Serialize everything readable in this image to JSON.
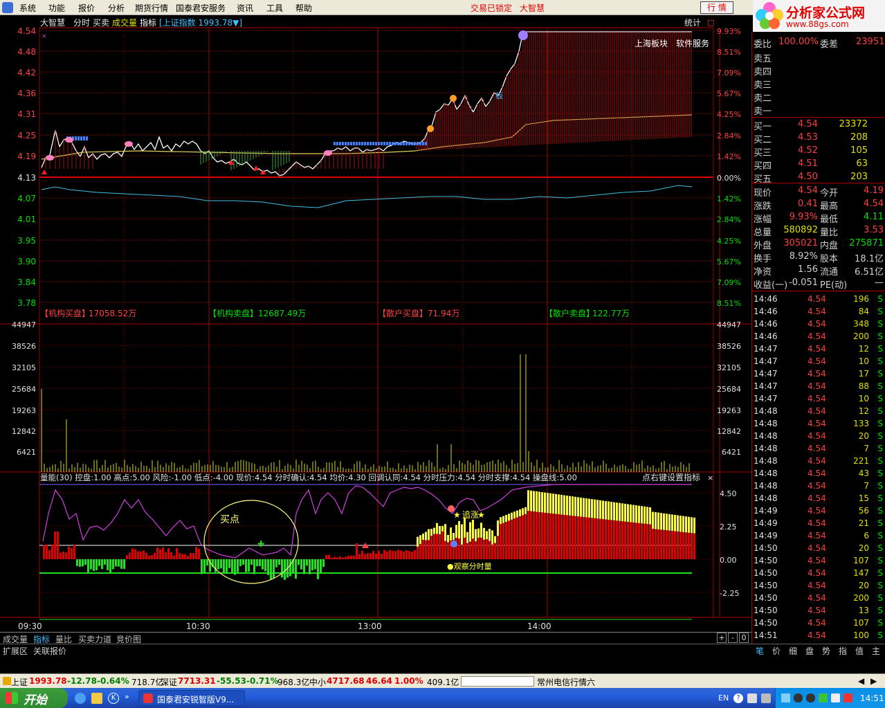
{
  "menu": {
    "items": [
      "系统",
      "功能",
      "报价",
      "分析",
      "期货行情",
      "国泰君安服务",
      "资讯",
      "工具",
      "帮助"
    ],
    "trade_locked": "交易已锁定",
    "brand": "大智慧",
    "hq_button": "行 情"
  },
  "watermark": {
    "text": "分析家公式网",
    "url": "www.88gs.com"
  },
  "chart": {
    "header": {
      "app": "大智慧",
      "tabs": [
        "分时",
        "买卖",
        "成交量",
        "指标"
      ],
      "index_info": "[上证指数 1993.78▼]",
      "stats": "统计",
      "sector": "上海板块",
      "service": "软件服务"
    },
    "price_axis": [
      "4.54",
      "4.48",
      "4.42",
      "4.36",
      "4.31",
      "4.25",
      "4.19",
      "4.13",
      "4.07",
      "4.01",
      "3.95",
      "3.90",
      "3.84",
      "3.78"
    ],
    "pct_axis": [
      "9.93%",
      "8.51%",
      "7.09%",
      "5.67%",
      "4.25%",
      "2.84%",
      "1.42%",
      "0.00%",
      "1.42%",
      "2.84%",
      "4.25%",
      "5.67%",
      "7.09%",
      "8.51%"
    ],
    "flow": [
      {
        "label": "【机构买盘】",
        "value": "17058.52万"
      },
      {
        "label": "【机构卖盘】",
        "value": "12687.49万"
      },
      {
        "label": "【散户买盘】",
        "value": "71.94万"
      },
      {
        "label": "【散户卖盘】",
        "value": "122.77万"
      }
    ],
    "vol_axis": [
      "44947",
      "38526",
      "32105",
      "25684",
      "19263",
      "12842",
      "6421"
    ],
    "indicator_header": "量能(30) 控盘:1.00 高点:5.00 风险:-1.00 低点:-4.00 现价:4.54 分时确认:4.54 均价:4.30 回调认同:4.54 分时压力:4.54 分时支撑:4.54 操盘线:5.00",
    "indicator_hint": "点右键设置指标",
    "ind_axis": [
      "4.50",
      "2.25",
      "0.00",
      "-2.25"
    ],
    "buy_point": "买点",
    "chase_label": "追涨",
    "watch_label": "●观察分时量",
    "board_label": "板",
    "time_axis": [
      "09:30",
      "10:30",
      "13:00",
      "14:00"
    ]
  },
  "bottom_tabs": [
    "成交量",
    "指标",
    "量比",
    "买卖力道",
    "竞价图"
  ],
  "ext_tabs": [
    "扩展区",
    "关联报价"
  ],
  "quote": {
    "header": {
      "label": "委比",
      "ratio": "100.00%",
      "diff_label": "委差",
      "diff": "23951"
    },
    "sells": [
      "卖五",
      "卖四",
      "卖三",
      "卖二",
      "卖一"
    ],
    "buys": [
      {
        "label": "买一",
        "price": "4.54",
        "vol": "23372"
      },
      {
        "label": "买二",
        "price": "4.53",
        "vol": "208"
      },
      {
        "label": "买三",
        "price": "4.52",
        "vol": "105"
      },
      {
        "label": "买四",
        "price": "4.51",
        "vol": "63"
      },
      {
        "label": "买五",
        "price": "4.50",
        "vol": "203"
      }
    ],
    "stats": [
      [
        {
          "k": "现价",
          "v": "4.54",
          "c": "#ff4040"
        },
        {
          "k": "今开",
          "v": "4.19",
          "c": "#ff4040"
        }
      ],
      [
        {
          "k": "涨跌",
          "v": "0.41",
          "c": "#ff4040"
        },
        {
          "k": "最高",
          "v": "4.54",
          "c": "#ff4040"
        }
      ],
      [
        {
          "k": "涨幅",
          "v": "9.93%",
          "c": "#ff4040"
        },
        {
          "k": "最低",
          "v": "4.11",
          "c": "#00e000"
        }
      ],
      [
        {
          "k": "总量",
          "v": "580892",
          "c": "#e0e000"
        },
        {
          "k": "量比",
          "v": "3.53",
          "c": "#ff4040"
        }
      ],
      [
        {
          "k": "外盘",
          "v": "305021",
          "c": "#ff4040"
        },
        {
          "k": "内盘",
          "v": "275871",
          "c": "#00e000"
        }
      ],
      [
        {
          "k": "换手",
          "v": "8.92%",
          "c": "#d0d0d0"
        },
        {
          "k": "股本",
          "v": "18.1亿",
          "c": "#d0d0d0"
        }
      ],
      [
        {
          "k": "净资",
          "v": "1.56",
          "c": "#d0d0d0"
        },
        {
          "k": "流通",
          "v": "6.51亿",
          "c": "#d0d0d0"
        }
      ],
      [
        {
          "k": "收益(一)",
          "v": "-0.051",
          "c": "#d0d0d0"
        },
        {
          "k": "PE(动)",
          "v": "—",
          "c": "#d0d0d0"
        }
      ]
    ],
    "ticks": [
      [
        "14:46",
        "4.54",
        "196",
        "S"
      ],
      [
        "14:46",
        "4.54",
        "84",
        "S"
      ],
      [
        "14:46",
        "4.54",
        "348",
        "S"
      ],
      [
        "14:46",
        "4.54",
        "200",
        "S"
      ],
      [
        "14:47",
        "4.54",
        "12",
        "S"
      ],
      [
        "14:47",
        "4.54",
        "10",
        "S"
      ],
      [
        "14:47",
        "4.54",
        "17",
        "S"
      ],
      [
        "14:47",
        "4.54",
        "88",
        "S"
      ],
      [
        "14:47",
        "4.54",
        "10",
        "S"
      ],
      [
        "14:48",
        "4.54",
        "12",
        "S"
      ],
      [
        "14:48",
        "4.54",
        "133",
        "S"
      ],
      [
        "14:48",
        "4.54",
        "20",
        "S"
      ],
      [
        "14:48",
        "4.54",
        "7",
        "S"
      ],
      [
        "14:48",
        "4.54",
        "221",
        "S"
      ],
      [
        "14:48",
        "4.54",
        "43",
        "S"
      ],
      [
        "14:48",
        "4.54",
        "7",
        "S"
      ],
      [
        "14:48",
        "4.54",
        "15",
        "S"
      ],
      [
        "14:49",
        "4.54",
        "56",
        "S"
      ],
      [
        "14:49",
        "4.54",
        "21",
        "S"
      ],
      [
        "14:49",
        "4.54",
        "6",
        "S"
      ],
      [
        "14:50",
        "4.54",
        "20",
        "S"
      ],
      [
        "14:50",
        "4.54",
        "107",
        "S"
      ],
      [
        "14:50",
        "4.54",
        "147",
        "S"
      ],
      [
        "14:50",
        "4.54",
        "20",
        "S"
      ],
      [
        "14:50",
        "4.54",
        "200",
        "S"
      ],
      [
        "14:50",
        "4.54",
        "13",
        "S"
      ],
      [
        "14:50",
        "4.54",
        "107",
        "S"
      ],
      [
        "14:51",
        "4.54",
        "100",
        "S"
      ]
    ],
    "bottom_tabs": [
      "笔",
      "价",
      "细",
      "盘",
      "势",
      "指",
      "值",
      "主"
    ]
  },
  "status": {
    "sh_label": "上证",
    "sh_val": "1993.78",
    "sh_chg": "-12.78",
    "sh_pct": "-0.64%",
    "sh_amt": "718.7亿",
    "sz_label": "深证",
    "sz_val": "7713.31",
    "sz_chg": "-55.53",
    "sz_pct": "-0.71%",
    "sz_amt": "968.3亿",
    "zx_label": "中小",
    "zx_val": "4717.68",
    "zx_chg": "46.64",
    "zx_pct": "1.00%",
    "zx_amt": "409.1亿",
    "ticker": "常州电信行情六"
  },
  "taskbar": {
    "start": "开始",
    "task": "国泰君安锐智版V9...",
    "lang": "EN",
    "clock": "14:51"
  }
}
